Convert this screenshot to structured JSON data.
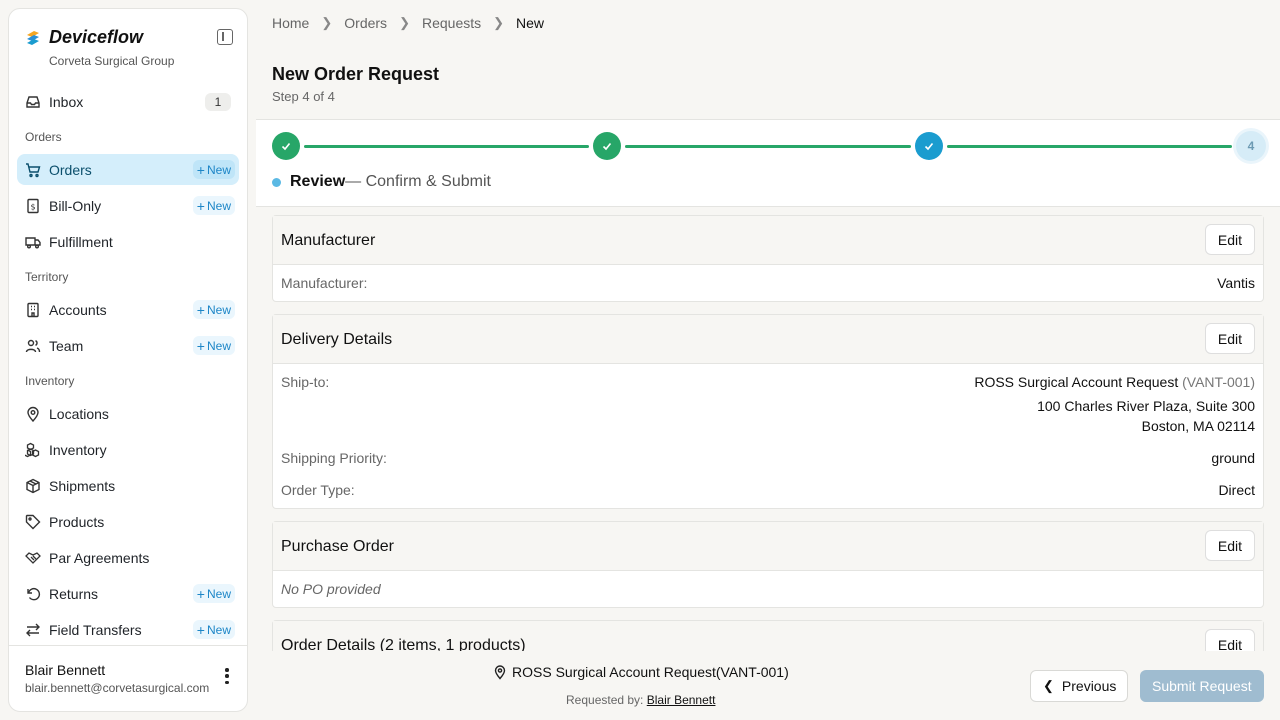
{
  "app": {
    "name": "Deviceflow",
    "org": "Corveta Surgical Group"
  },
  "colors": {
    "accent": "#1a9ccf",
    "done": "#27a668",
    "active_bg": "#d4eefb"
  },
  "sidebar": {
    "inbox": {
      "label": "Inbox",
      "count": "1",
      "icon": "inbox-icon"
    },
    "sections": {
      "orders": "Orders",
      "territory": "Territory",
      "inventory": "Inventory"
    },
    "new_label": "New",
    "items": [
      {
        "label": "Orders",
        "icon": "cart-icon",
        "new": true,
        "active": true
      },
      {
        "label": "Bill-Only",
        "icon": "receipt-icon",
        "new": true
      },
      {
        "label": "Fulfillment",
        "icon": "truck-icon",
        "new": false
      },
      {
        "label": "Accounts",
        "icon": "building-icon",
        "new": true
      },
      {
        "label": "Team",
        "icon": "users-icon",
        "new": true
      },
      {
        "label": "Locations",
        "icon": "map-pin-icon",
        "new": false
      },
      {
        "label": "Inventory",
        "icon": "boxes-icon",
        "new": false
      },
      {
        "label": "Shipments",
        "icon": "package-icon",
        "new": false
      },
      {
        "label": "Products",
        "icon": "tag-icon",
        "new": false
      },
      {
        "label": "Par Agreements",
        "icon": "handshake-icon",
        "new": false
      },
      {
        "label": "Returns",
        "icon": "rotate-ccw-icon",
        "new": true
      },
      {
        "label": "Field Transfers",
        "icon": "arrows-icon",
        "new": true
      }
    ],
    "user": {
      "name": "Blair Bennett",
      "email": "blair.bennett@corvetasurgical.com"
    }
  },
  "breadcrumb": [
    "Home",
    "Orders",
    "Requests",
    "New"
  ],
  "page": {
    "title": "New Order Request",
    "subtitle": "Step 4 of 4"
  },
  "stepper": {
    "current_step": "4",
    "label_strong": "Review",
    "label_rest": "— Confirm & Submit"
  },
  "cards": {
    "edit_label": "Edit",
    "manufacturer": {
      "title": "Manufacturer",
      "key": "Manufacturer:",
      "value": "Vantis"
    },
    "delivery": {
      "title": "Delivery Details",
      "ship_to_key": "Ship-to:",
      "ship_to_name": "ROSS Surgical Account Request",
      "ship_to_code": "(VANT-001)",
      "addr1": "100 Charles River Plaza, Suite 300",
      "addr2": "Boston, MA 02114",
      "priority_key": "Shipping Priority:",
      "priority_value": "ground",
      "type_key": "Order Type:",
      "type_value": "Direct"
    },
    "po": {
      "title": "Purchase Order",
      "empty": "No PO provided"
    },
    "order_details": {
      "title": "Order Details (2 items, 1 products)"
    }
  },
  "footer": {
    "account": "ROSS Surgical Account Request(VANT-001)",
    "requested_by_label": "Requested by:",
    "requested_by": "Blair Bennett",
    "prev_label": "Previous",
    "submit_label": "Submit Request"
  }
}
